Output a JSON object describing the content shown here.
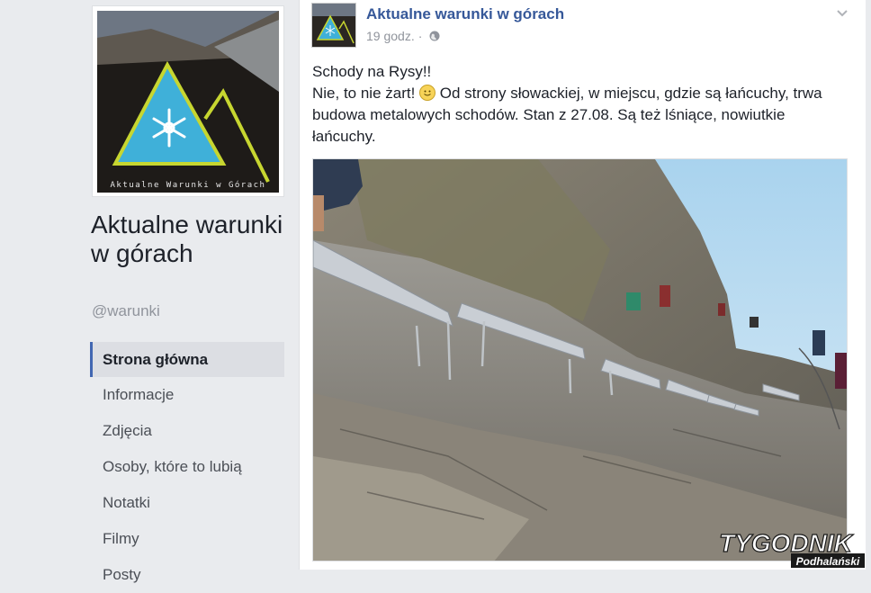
{
  "sidebar": {
    "cover_caption": "Aktualne Warunki w Górach",
    "page_name": "Aktualne warunki w górach",
    "handle": "@warunki",
    "nav": [
      {
        "label": "Strona główna",
        "active": true
      },
      {
        "label": "Informacje",
        "active": false
      },
      {
        "label": "Zdjęcia",
        "active": false
      },
      {
        "label": "Osoby, które to lubią",
        "active": false
      },
      {
        "label": "Notatki",
        "active": false
      },
      {
        "label": "Filmy",
        "active": false
      },
      {
        "label": "Posty",
        "active": false
      }
    ]
  },
  "post": {
    "author": "Aktualne warunki w górach",
    "time": "19 godz.",
    "separator": "·",
    "privacy_icon": "globe-icon",
    "menu_icon": "chevron-down-icon",
    "text_line1": "Schody na Rysy!!",
    "text_line2_a": "Nie, to nie żart!",
    "text_line2_b": " Od strony słowackiej, w miejscu, gdzie są łańcuchy, trwa budowa metalowych schodów. Stan z 27.08. Są też lśniące, nowiutkie łańcuchy.",
    "emoji": "smile-emoji"
  },
  "watermark": {
    "brand": "TYGODNIK",
    "sub": "Podhalański"
  },
  "colors": {
    "link": "#365899",
    "nav_active_border": "#4267b2",
    "logo_triangle": "#3fb0d9",
    "logo_outline": "#c7d630",
    "background": "#e9ebee"
  }
}
